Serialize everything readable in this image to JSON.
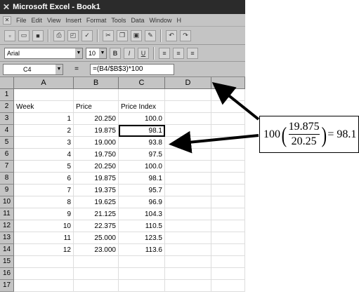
{
  "window": {
    "title": "Microsoft Excel - Book1"
  },
  "menu": [
    "File",
    "Edit",
    "View",
    "Insert",
    "Format",
    "Tools",
    "Data",
    "Window",
    "H"
  ],
  "toolbar": {
    "font_name": "Arial",
    "font_size": "10"
  },
  "formula_bar": {
    "cell_ref": "C4",
    "equals": "=",
    "formula": "=(B4/$B$3)*100"
  },
  "columns": [
    "A",
    "B",
    "C",
    "D"
  ],
  "rows": [
    {
      "n": "1",
      "a": "",
      "b": "",
      "c": ""
    },
    {
      "n": "2",
      "a": "Week",
      "b": "Price",
      "c": "Price Index"
    },
    {
      "n": "3",
      "a": "",
      "b_week": "1",
      "b": "20.250",
      "c": "100.0"
    },
    {
      "n": "4",
      "a": "",
      "b_week": "2",
      "b": "19.875",
      "c": "98.1"
    },
    {
      "n": "5",
      "a": "",
      "b_week": "3",
      "b": "19.000",
      "c": "93.8"
    },
    {
      "n": "6",
      "a": "",
      "b_week": "4",
      "b": "19.750",
      "c": "97.5"
    },
    {
      "n": "7",
      "a": "",
      "b_week": "5",
      "b": "20.250",
      "c": "100.0"
    },
    {
      "n": "8",
      "a": "",
      "b_week": "6",
      "b": "19.875",
      "c": "98.1"
    },
    {
      "n": "9",
      "a": "",
      "b_week": "7",
      "b": "19.375",
      "c": "95.7"
    },
    {
      "n": "10",
      "a": "",
      "b_week": "8",
      "b": "19.625",
      "c": "96.9"
    },
    {
      "n": "11",
      "a": "",
      "b_week": "9",
      "b": "21.125",
      "c": "104.3"
    },
    {
      "n": "12",
      "a": "",
      "b_week": "10",
      "b": "22.375",
      "c": "110.5"
    },
    {
      "n": "13",
      "a": "",
      "b_week": "11",
      "b": "25.000",
      "c": "123.5"
    },
    {
      "n": "14",
      "a": "",
      "b_week": "12",
      "b": "23.000",
      "c": "113.6"
    },
    {
      "n": "15",
      "a": "",
      "b": "",
      "c": ""
    },
    {
      "n": "16",
      "a": "",
      "b": "",
      "c": ""
    },
    {
      "n": "17",
      "a": "",
      "b": "",
      "c": ""
    }
  ],
  "annotation": {
    "coef": "100",
    "numerator": "19.875",
    "denominator": "20.25",
    "result": "= 98.1"
  }
}
